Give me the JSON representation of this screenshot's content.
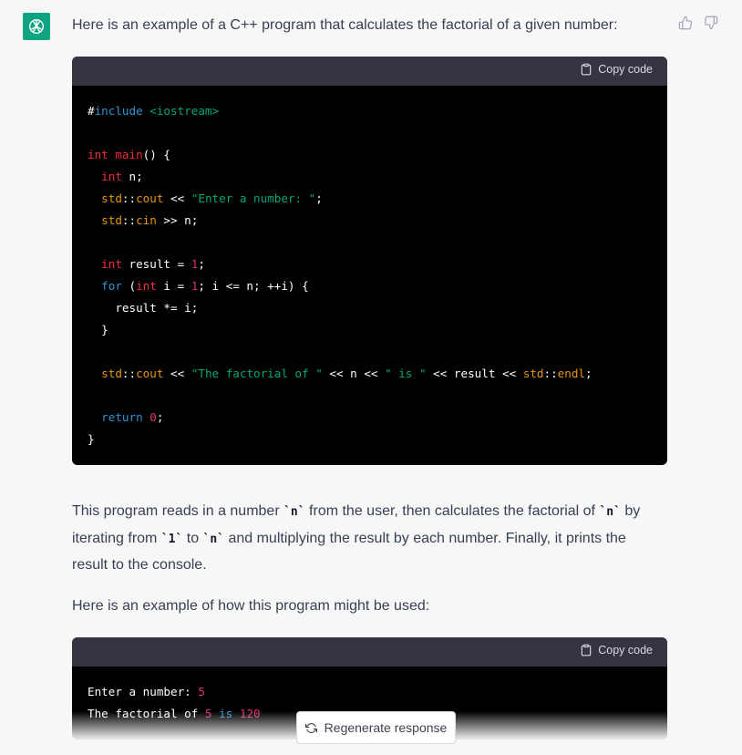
{
  "message": {
    "intro": "Here is an example of a C++ program that calculates the factorial of a given number:",
    "explanation": {
      "part1": "This program reads in a number ",
      "code_n1": "`n`",
      "part2": " from the user, then calculates the factorial of ",
      "code_n2": "`n`",
      "part3": " by iterating from ",
      "code_1": "`1`",
      "part4": " to ",
      "code_n3": "`n`",
      "part5": " and multiplying the result by each number. Finally, it prints the result to the console."
    },
    "usage_intro": "Here is an example of how this program might be used:"
  },
  "code_block_1": {
    "copy_label": "Copy code",
    "lines": {
      "l1_hash": "#",
      "l1_kw": "include",
      "l1_hdr": " <iostream>",
      "l3_int": "int",
      "l3_main": " main",
      "l3_rest": "() {",
      "l4_int": "int",
      "l4_rest": " n;",
      "l5_std": "std",
      "l5_sep": "::",
      "l5_cout": "cout",
      "l5_op": " << ",
      "l5_str": "\"Enter a number: \"",
      "l5_end": ";",
      "l6_std": "std",
      "l6_sep": "::",
      "l6_cin": "cin",
      "l6_rest": " >> n;",
      "l8_int": "int",
      "l8_rest": " result = ",
      "l8_num": "1",
      "l8_end": ";",
      "l9_for": "for",
      "l9_open": " (",
      "l9_int": "int",
      "l9_a": " i = ",
      "l9_num": "1",
      "l9_b": "; i <= n; ++i) {",
      "l10": "    result *= i;",
      "l11": "  }",
      "l13_std1": "std",
      "l13_sep1": "::",
      "l13_cout": "cout",
      "l13_op1": " << ",
      "l13_str1": "\"The factorial of \"",
      "l13_mid1": " << n << ",
      "l13_str2": "\" is \"",
      "l13_mid2": " << result << ",
      "l13_std2": "std",
      "l13_sep2": "::",
      "l13_endl": "endl",
      "l13_end": ";",
      "l15_ret": "return",
      "l15_sp": " ",
      "l15_num": "0",
      "l15_end": ";",
      "l16": "}"
    }
  },
  "code_block_2": {
    "copy_label": "Copy code",
    "out1_text": "Enter a number: ",
    "out1_num": "5",
    "out2_a": "The factorial of ",
    "out2_num1": "5",
    "out2_sp": " ",
    "out2_is": "is",
    "out2_sp2": " ",
    "out2_num2": "120"
  },
  "regenerate_label": "Regenerate response",
  "colors": {
    "page_bg": "#f7f7f8",
    "avatar": "#10a37f",
    "code_bg": "#000000",
    "code_header": "#343541"
  }
}
